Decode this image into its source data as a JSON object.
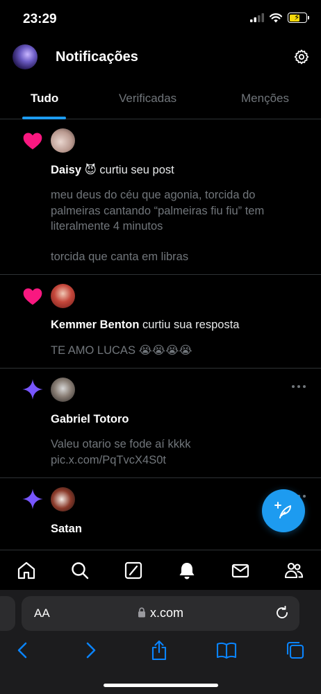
{
  "status_bar": {
    "time": "23:29"
  },
  "header": {
    "title": "Notificações"
  },
  "tabs": [
    {
      "label": "Tudo",
      "active": true
    },
    {
      "label": "Verificadas",
      "active": false
    },
    {
      "label": "Menções",
      "active": false
    }
  ],
  "notifications": [
    {
      "type": "like",
      "user": "Daisy",
      "emoji": "😈",
      "action": "curtiu seu post",
      "text": "meu deus do céu que agonia, torcida do palmeiras cantando “palmeiras fiu fiu” tem literalmente 4 minutos",
      "text2": "torcida que canta em libras"
    },
    {
      "type": "like",
      "user": "Kemmer Benton",
      "action": "curtiu sua resposta",
      "text": "TE AMO LUCAS 😭😭😭😭"
    },
    {
      "type": "post",
      "user": "Gabriel Totoro",
      "text": "Valeu otario se fode aí kkkk",
      "text2": "pic.x.com/PqTvcX4S0t"
    },
    {
      "type": "post",
      "user": "Satan"
    }
  ],
  "safari": {
    "aa_label": "AA",
    "url": "x.com"
  },
  "colors": {
    "accent": "#1d9bf0",
    "like": "#f91880",
    "star": "#7856ff",
    "muted": "#71767b"
  }
}
